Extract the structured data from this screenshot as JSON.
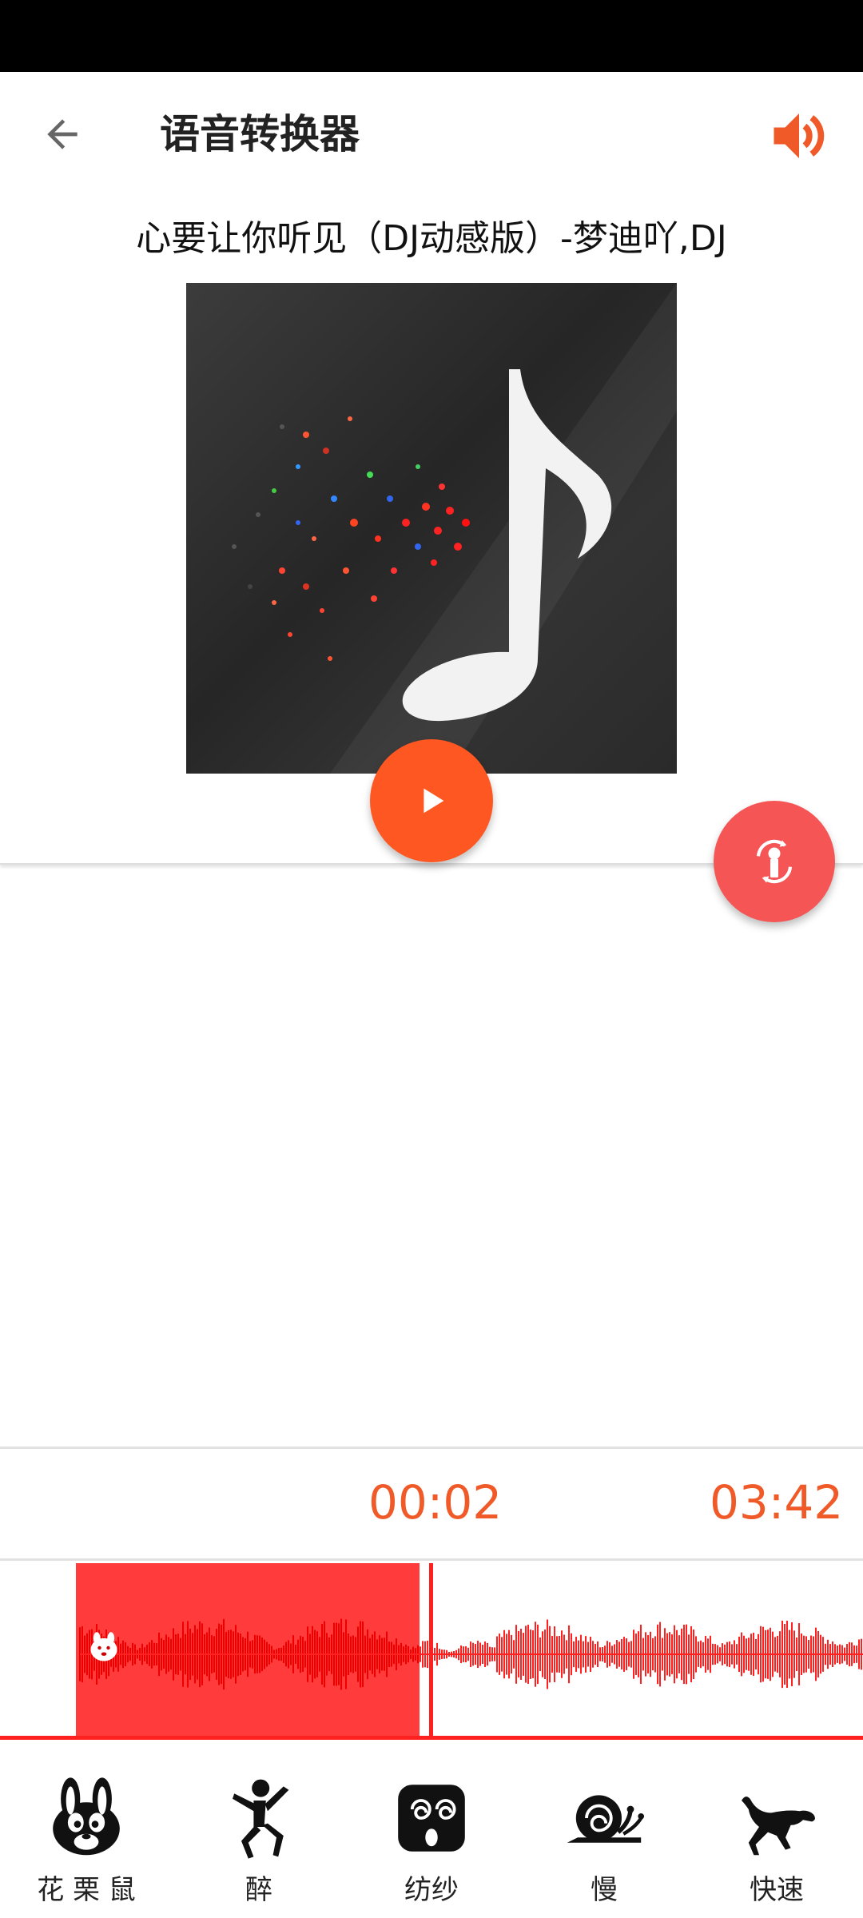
{
  "app": {
    "title": "语音转换器"
  },
  "song": {
    "title": "心要让你听见（DJ动感版）-梦迪吖,DJ"
  },
  "player": {
    "current_time": "00:02",
    "total_time": "03:42"
  },
  "colors": {
    "accent": "#ff5722",
    "fab": "#f65555",
    "wave": "#ff2020",
    "time_text": "#f05a28"
  },
  "effects": [
    {
      "label": "花 栗 鼠",
      "icon": "chipmunk-icon"
    },
    {
      "label": "醉",
      "icon": "drunk-person-icon"
    },
    {
      "label": "纺纱",
      "icon": "spiral-face-icon"
    },
    {
      "label": "慢",
      "icon": "snail-icon"
    },
    {
      "label": "快速",
      "icon": "cheetah-icon"
    }
  ]
}
